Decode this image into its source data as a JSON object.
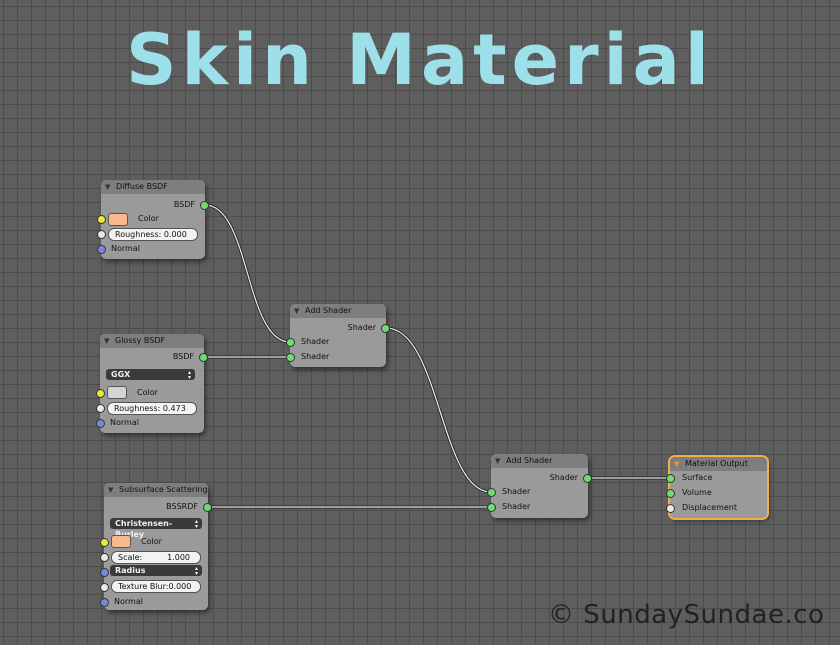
{
  "title": "Skin Material",
  "copyright": "© SundaySundae.co",
  "colors": {
    "title": "#9ee0ea",
    "shader_socket": "#6fdc6f",
    "color_socket": "#e8e83a",
    "value_socket": "#e8e8e8",
    "vector_socket": "#7a86d8",
    "active_node": "#f2b04a",
    "skin_swatch": "#f8b98c"
  },
  "nodes": {
    "diffuse": {
      "title": "Diffuse BSDF",
      "output": "BSDF",
      "color_label": "Color",
      "roughness": "Roughness: 0.000",
      "normal_label": "Normal"
    },
    "glossy": {
      "title": "Glossy BSDF",
      "output": "BSDF",
      "distribution": "GGX",
      "color_label": "Color",
      "roughness": "Roughness: 0.473",
      "normal_label": "Normal"
    },
    "sss": {
      "title": "Subsurface Scattering",
      "output": "BSSRDF",
      "falloff": "Christensen-Burley",
      "color_label": "Color",
      "scale_label": "Scale:",
      "scale_value": "1.000",
      "radius": "Radius",
      "texture_blur": "Texture Blur:0.000",
      "normal_label": "Normal"
    },
    "add1": {
      "title": "Add Shader",
      "output": "Shader",
      "in1": "Shader",
      "in2": "Shader"
    },
    "add2": {
      "title": "Add Shader",
      "output": "Shader",
      "in1": "Shader",
      "in2": "Shader"
    },
    "output": {
      "title": "Material Output",
      "surface": "Surface",
      "volume": "Volume",
      "displacement": "Displacement"
    }
  }
}
